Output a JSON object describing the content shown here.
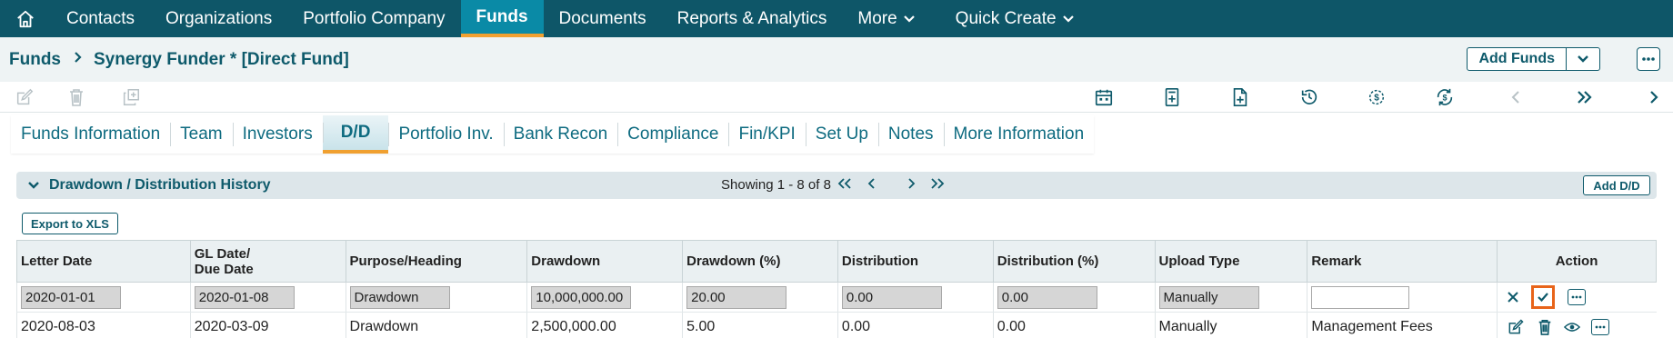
{
  "nav": {
    "items": [
      {
        "label": "Contacts"
      },
      {
        "label": "Organizations"
      },
      {
        "label": "Portfolio Company"
      },
      {
        "label": "Funds",
        "active": true
      },
      {
        "label": "Documents"
      },
      {
        "label": "Reports & Analytics"
      },
      {
        "label": "More",
        "dropdown": true
      },
      {
        "label": "Quick Create",
        "dropdown": true
      }
    ]
  },
  "breadcrumb": {
    "root": "Funds",
    "current": "Synergy Funder * [Direct Fund]"
  },
  "header": {
    "add_funds_label": "Add Funds"
  },
  "tabs": [
    {
      "label": "Funds Information"
    },
    {
      "label": "Team"
    },
    {
      "label": "Investors"
    },
    {
      "label": "D/D",
      "active": true
    },
    {
      "label": "Portfolio Inv."
    },
    {
      "label": "Bank Recon"
    },
    {
      "label": "Compliance"
    },
    {
      "label": "Fin/KPI"
    },
    {
      "label": "Set Up"
    },
    {
      "label": "Notes"
    },
    {
      "label": "More Information"
    }
  ],
  "section": {
    "title": "Drawdown / Distribution History",
    "showing": "Showing 1 - 8 of 8",
    "add_button": "Add D/D",
    "export_button": "Export to XLS"
  },
  "table": {
    "headers": {
      "letter_date": "Letter Date",
      "gl_date_1": "GL Date/",
      "gl_date_2": "Due Date",
      "purpose": "Purpose/Heading",
      "drawdown": "Drawdown",
      "drawdown_pct": "Drawdown (%)",
      "distribution": "Distribution",
      "distribution_pct": "Distribution (%)",
      "upload_type": "Upload Type",
      "remark": "Remark",
      "action": "Action"
    },
    "edit_row": {
      "letter_date": "2020-01-01",
      "gl_date": "2020-01-08",
      "purpose": "Drawdown",
      "drawdown": "10,000,000.00",
      "drawdown_pct": "20.00",
      "distribution": "0.00",
      "distribution_pct": "0.00",
      "upload_type": "Manually",
      "remark": ""
    },
    "rows": [
      {
        "letter_date": "2020-08-03",
        "gl_date": "2020-03-09",
        "purpose": "Drawdown",
        "drawdown": "2,500,000.00",
        "drawdown_pct": "5.00",
        "distribution": "0.00",
        "distribution_pct": "0.00",
        "upload_type": "Manually",
        "remark": "Management Fees"
      }
    ]
  },
  "colors": {
    "nav_bg": "#0e5668",
    "active_tab": "#0a8aa6",
    "accent_orange": "#f0a030",
    "highlight": "#e8641a"
  }
}
